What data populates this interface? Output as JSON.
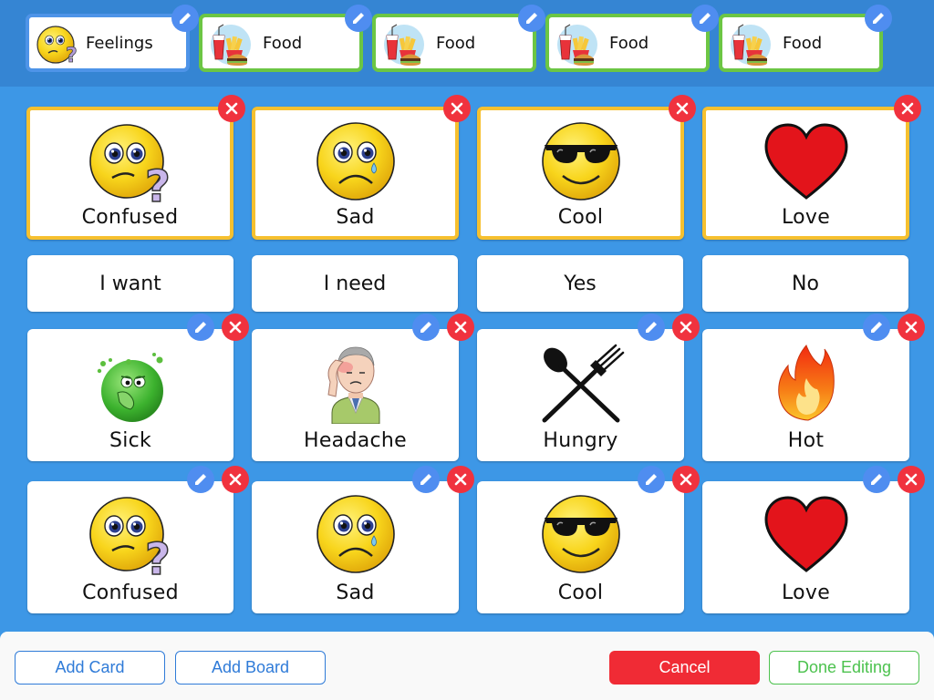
{
  "colors": {
    "background": "#3d97e6",
    "topbar": "#3585d3",
    "tab_active_border": "#4e94e8",
    "tab_border": "#6cc644",
    "card_highlight_border": "#f6c02f",
    "edit_badge": "#4f8df0",
    "delete_badge": "#f0323e",
    "cancel": "#f02b35",
    "done": "#4cc24e",
    "primary_outline": "#2f7bd8"
  },
  "tabs": [
    {
      "label": "Feelings",
      "icon": "confused-face-icon",
      "active": true
    },
    {
      "label": "Food",
      "icon": "fast-food-icon"
    },
    {
      "label": "Food",
      "icon": "fast-food-icon"
    },
    {
      "label": "Food",
      "icon": "fast-food-icon"
    },
    {
      "label": "Food",
      "icon": "fast-food-icon"
    }
  ],
  "top_cards": [
    {
      "label": "Confused",
      "icon": "confused-face-icon"
    },
    {
      "label": "Sad",
      "icon": "sad-face-icon"
    },
    {
      "label": "Cool",
      "icon": "sunglasses-face-icon"
    },
    {
      "label": "Love",
      "icon": "heart-icon"
    }
  ],
  "phrases": [
    "I want",
    "I need",
    "Yes",
    "No"
  ],
  "cards_row1": [
    {
      "label": "Sick",
      "icon": "sick-face-icon"
    },
    {
      "label": "Headache",
      "icon": "headache-person-icon"
    },
    {
      "label": "Hungry",
      "icon": "spoon-fork-icon"
    },
    {
      "label": "Hot",
      "icon": "flame-icon"
    }
  ],
  "cards_row2": [
    {
      "label": "Confused",
      "icon": "confused-face-icon"
    },
    {
      "label": "Sad",
      "icon": "sad-face-icon"
    },
    {
      "label": "Cool",
      "icon": "sunglasses-face-icon"
    },
    {
      "label": "Love",
      "icon": "heart-icon"
    }
  ],
  "buttons": {
    "add_card": "Add Card",
    "add_board": "Add Board",
    "cancel": "Cancel",
    "done": "Done Editing"
  }
}
